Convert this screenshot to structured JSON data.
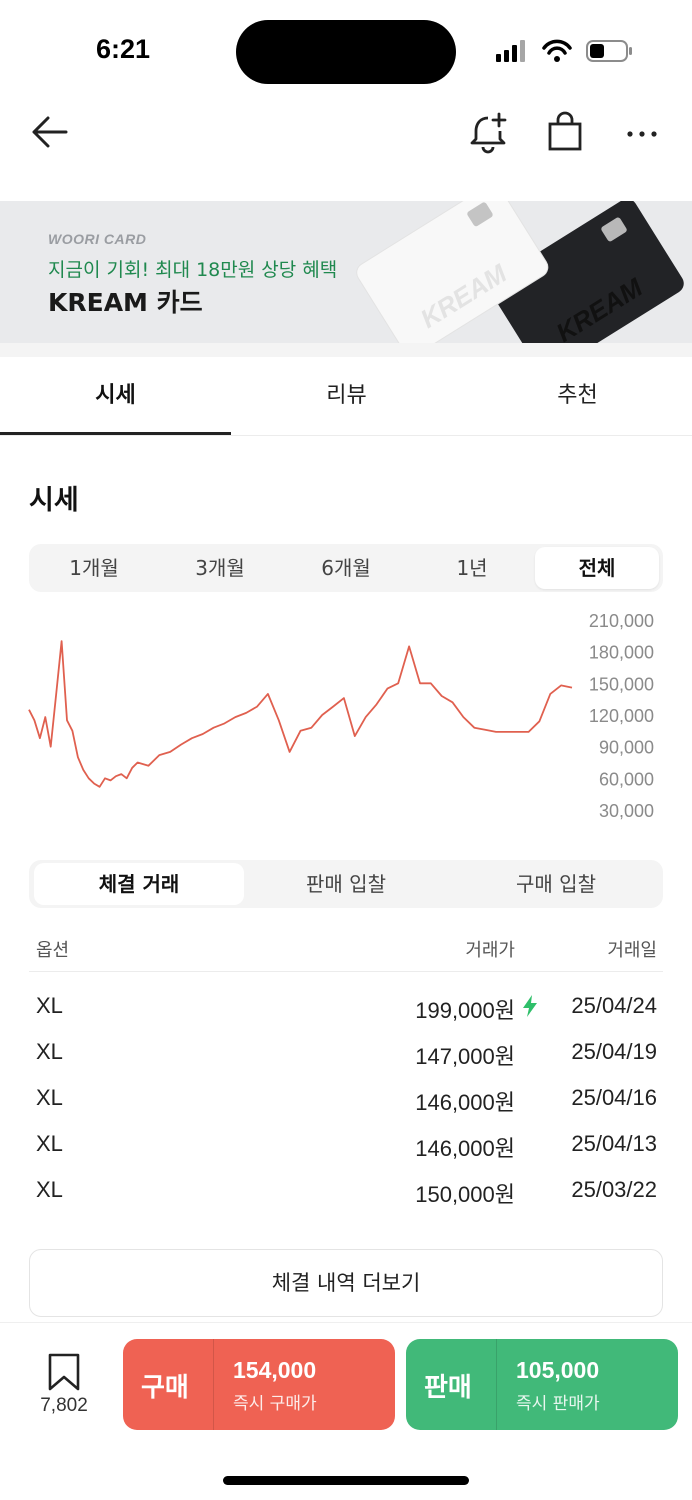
{
  "status": {
    "time": "6:21"
  },
  "banner": {
    "brand": "WOORI CARD",
    "promo": "지금이 기회! 최대 18만원 상당 혜택",
    "title": "KREAM 카드",
    "card_text": "KREAM"
  },
  "tabs": [
    {
      "label": "시세",
      "active": true
    },
    {
      "label": "리뷰",
      "active": false
    },
    {
      "label": "추천",
      "active": false
    }
  ],
  "price_section": {
    "title": "시세",
    "periods": [
      "1개월",
      "3개월",
      "6개월",
      "1년",
      "전체"
    ],
    "selected_period": "전체"
  },
  "chart_data": {
    "type": "line",
    "color": "#e0604f",
    "y_ticks": [
      "210,000",
      "180,000",
      "150,000",
      "120,000",
      "90,000",
      "60,000",
      "30,000"
    ],
    "ylim": [
      30000,
      210000
    ],
    "x_index_range": [
      0,
      100
    ],
    "series": [
      {
        "x": [
          0,
          1,
          2,
          3,
          4,
          5,
          6,
          7,
          8,
          9,
          10,
          11,
          12,
          13,
          14,
          15,
          16,
          17,
          18,
          19,
          20,
          22,
          24,
          26,
          28,
          30,
          32,
          34,
          36,
          38,
          40,
          42,
          44,
          46,
          48,
          50,
          52,
          54,
          56,
          58,
          60,
          62,
          64,
          66,
          68,
          70,
          72,
          74,
          76,
          78,
          80,
          82,
          84,
          86,
          88,
          90,
          92,
          94,
          96,
          98,
          100
        ],
        "values": [
          125000,
          115000,
          98000,
          118000,
          90000,
          140000,
          190000,
          115000,
          105000,
          80000,
          68000,
          60000,
          55000,
          52000,
          60000,
          58000,
          62000,
          64000,
          60000,
          70000,
          75000,
          72000,
          82000,
          85000,
          92000,
          98000,
          102000,
          108000,
          112000,
          118000,
          122000,
          128000,
          140000,
          115000,
          85000,
          105000,
          108000,
          120000,
          128000,
          136000,
          100000,
          118000,
          130000,
          145000,
          150000,
          185000,
          150000,
          150000,
          138000,
          132000,
          118000,
          108000,
          106000,
          104000,
          104000,
          104000,
          104000,
          114000,
          140000,
          148000,
          146000
        ]
      }
    ]
  },
  "trade_tabs": [
    {
      "label": "체결 거래",
      "active": true
    },
    {
      "label": "판매 입찰",
      "active": false
    },
    {
      "label": "구매 입찰",
      "active": false
    }
  ],
  "trade_table": {
    "headers": {
      "option": "옵션",
      "price": "거래가",
      "date": "거래일"
    },
    "rows": [
      {
        "option": "XL",
        "price": "199,000원",
        "date": "25/04/24",
        "fast": true
      },
      {
        "option": "XL",
        "price": "147,000원",
        "date": "25/04/19",
        "fast": false
      },
      {
        "option": "XL",
        "price": "146,000원",
        "date": "25/04/16",
        "fast": false
      },
      {
        "option": "XL",
        "price": "146,000원",
        "date": "25/04/13",
        "fast": false
      },
      {
        "option": "XL",
        "price": "150,000원",
        "date": "25/03/22",
        "fast": false
      }
    ],
    "more_label": "체결 내역 더보기"
  },
  "bottom_bar": {
    "bookmark_count": "7,802",
    "buy": {
      "label": "구매",
      "price": "154,000",
      "sub": "즉시 구매가",
      "color": "#ef6253"
    },
    "sell": {
      "label": "판매",
      "price": "105,000",
      "sub": "즉시 판매가",
      "color": "#41b979"
    }
  }
}
